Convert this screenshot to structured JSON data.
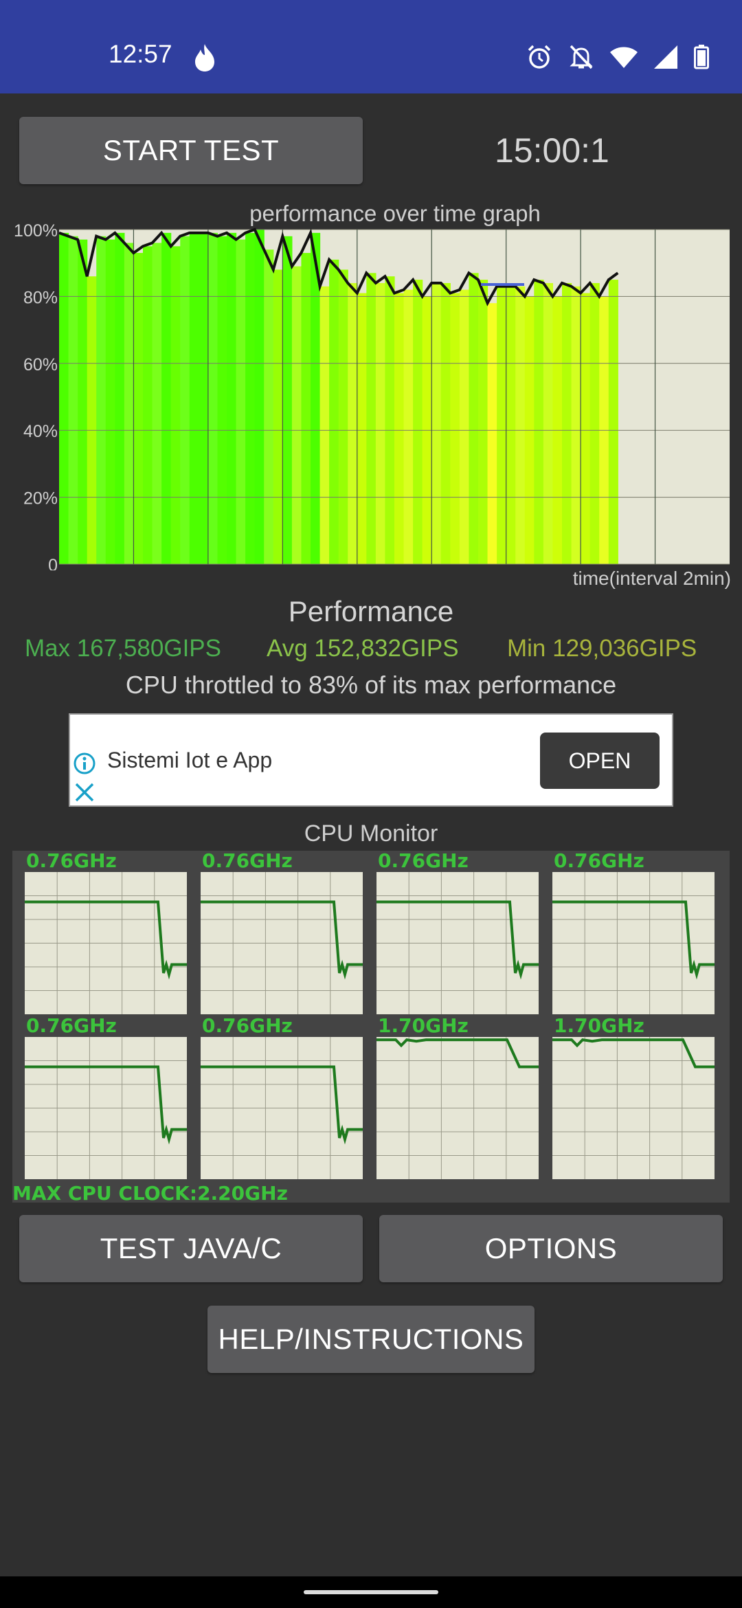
{
  "status_bar": {
    "time": "12:57",
    "icons": [
      "flame-icon",
      "alarm-icon",
      "bell-off-icon",
      "wifi-icon",
      "signal-icon",
      "battery-icon"
    ]
  },
  "controls": {
    "start_label": "START TEST",
    "timer": "15:00:1"
  },
  "perf_graph": {
    "title": "performance over time graph",
    "x_label": "time(interval 2min)",
    "y_ticks": [
      "100%",
      "80%",
      "60%",
      "40%",
      "20%",
      "0"
    ]
  },
  "chart_data": {
    "type": "area",
    "title": "performance over time graph",
    "xlabel": "time(interval 2min)",
    "ylabel": "",
    "ylim": [
      0,
      100
    ],
    "y_ticks": [
      "0",
      "20%",
      "40%",
      "60%",
      "80%",
      "100%"
    ],
    "grid": true,
    "x": [
      0,
      0.25,
      0.5,
      0.75,
      1,
      1.25,
      1.5,
      1.75,
      2,
      2.25,
      2.5,
      2.75,
      3,
      3.25,
      3.5,
      3.75,
      4,
      4.25,
      4.5,
      4.75,
      5,
      5.25,
      5.5,
      5.75,
      6,
      6.25,
      6.5,
      6.75,
      7,
      7.25,
      7.5,
      7.75,
      8,
      8.25,
      8.5,
      8.75,
      9,
      9.25,
      9.5,
      9.75,
      10,
      10.25,
      10.5,
      10.75,
      11,
      11.25,
      11.5,
      11.75,
      12,
      12.25,
      12.5,
      12.75,
      13,
      13.25,
      13.5,
      13.75,
      14,
      14.25,
      14.5,
      14.75,
      15
    ],
    "series": [
      {
        "values": [
          99,
          98,
          97,
          86,
          98,
          97,
          99,
          96,
          93,
          95,
          96,
          99,
          95,
          98,
          99,
          99,
          99,
          98,
          99,
          97,
          99,
          100,
          94,
          88,
          98,
          89,
          93,
          99,
          83,
          91,
          88,
          84,
          81,
          87,
          84,
          86,
          81,
          82,
          85,
          80,
          84,
          84,
          81,
          82,
          87,
          85,
          78,
          83,
          83,
          83,
          80,
          85,
          84,
          80,
          84,
          83,
          81,
          84,
          80,
          85,
          87
        ]
      }
    ]
  },
  "performance": {
    "heading": "Performance",
    "max": "Max 167,580GIPS",
    "avg": "Avg 152,832GIPS",
    "min": "Min 129,036GIPS",
    "throttle_text": "CPU throttled to 83% of its max performance",
    "colors": {
      "max": "#4caf50",
      "avg": "#8bc34a",
      "min": "#a8b43c"
    }
  },
  "ad": {
    "text": "Sistemi Iot e App",
    "button": "OPEN"
  },
  "cpu_monitor": {
    "title": "CPU Monitor",
    "max_clock": "MAX CPU CLOCK:2.20GHz",
    "cores": [
      {
        "freq": "0.76GHz",
        "profile": "drop",
        "levels": [
          0.79,
          0.79,
          0.79,
          0.79,
          0.79,
          0.79,
          0.79,
          0.79,
          0.29,
          0.35,
          0.28,
          0.35
        ]
      },
      {
        "freq": "0.76GHz",
        "profile": "drop",
        "levels": [
          0.79,
          0.79,
          0.79,
          0.79,
          0.79,
          0.79,
          0.79,
          0.79,
          0.29,
          0.35,
          0.28,
          0.35
        ]
      },
      {
        "freq": "0.76GHz",
        "profile": "drop",
        "levels": [
          0.79,
          0.79,
          0.79,
          0.79,
          0.79,
          0.79,
          0.79,
          0.79,
          0.29,
          0.35,
          0.28,
          0.35
        ]
      },
      {
        "freq": "0.76GHz",
        "profile": "drop",
        "levels": [
          0.79,
          0.79,
          0.79,
          0.79,
          0.79,
          0.79,
          0.79,
          0.79,
          0.29,
          0.35,
          0.28,
          0.35
        ]
      },
      {
        "freq": "0.76GHz",
        "profile": "drop",
        "levels": [
          0.79,
          0.79,
          0.79,
          0.79,
          0.79,
          0.79,
          0.79,
          0.79,
          0.29,
          0.35,
          0.28,
          0.35
        ]
      },
      {
        "freq": "0.76GHz",
        "profile": "drop",
        "levels": [
          0.79,
          0.79,
          0.79,
          0.79,
          0.79,
          0.79,
          0.79,
          0.79,
          0.29,
          0.35,
          0.28,
          0.35
        ]
      },
      {
        "freq": "1.70GHz",
        "profile": "high",
        "levels": [
          0.98,
          0.98,
          0.94,
          0.98,
          0.97,
          0.98,
          0.98,
          0.98,
          0.98,
          0.98,
          0.79,
          0.79
        ]
      },
      {
        "freq": "1.70GHz",
        "profile": "high",
        "levels": [
          0.98,
          0.98,
          0.94,
          0.98,
          0.97,
          0.98,
          0.98,
          0.98,
          0.98,
          0.98,
          0.79,
          0.79
        ]
      }
    ]
  },
  "buttons": {
    "test_java": "TEST JAVA/C",
    "options": "OPTIONS",
    "help": "HELP/INSTRUCTIONS"
  },
  "colors": {
    "status_bar": "#303f9f",
    "background": "#2f2f2f",
    "button": "#5a5a5c",
    "plot_bg": "#e6e6d6",
    "cpu_line": "#1e7a1e",
    "cpu_label": "#3cc43c"
  }
}
